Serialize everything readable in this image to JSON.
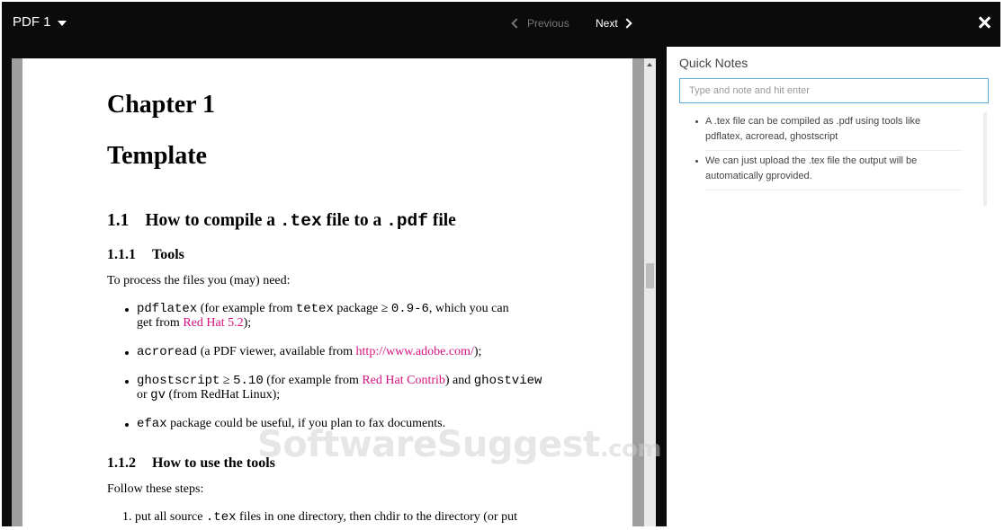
{
  "header": {
    "doc_selector": "PDF 1",
    "prev_label": "Previous",
    "next_label": "Next"
  },
  "document": {
    "chapter": "Chapter 1",
    "title": "Template",
    "section": {
      "number": "1.1",
      "pre": "How to compile a",
      "code1": ".tex",
      "mid": "file to a",
      "code2": ".pdf",
      "post": "file"
    },
    "sub1": {
      "number": "1.1.1",
      "title": "Tools"
    },
    "intro": "To process the files you (may) need:",
    "bullets": {
      "b1": {
        "code": "pdflatex",
        "t1": "(for example from",
        "code2": "tetex",
        "t2": "package ≥",
        "code3": "0.9-6",
        "t3": ", which you can",
        "line2": "get from",
        "link": "Red Hat 5.2",
        "end": ");"
      },
      "b2": {
        "code": "acroread",
        "t1": "(a PDF viewer, available from",
        "link": "http://www.adobe.com/",
        "end": ");"
      },
      "b3": {
        "code": "ghostscript",
        "t1": "≥",
        "code2": "5.10",
        "t2": "(for example from",
        "link": "Red Hat Contrib",
        "t3": ") and",
        "code3": "ghostview",
        "line2a": "or",
        "code4": "gv",
        "line2b": "(from RedHat Linux);"
      },
      "b4": {
        "code": "efax",
        "t1": "package could be useful, if you plan to fax documents."
      }
    },
    "sub2": {
      "number": "1.1.2",
      "title": "How to use the tools"
    },
    "steps_intro": "Follow these steps:",
    "step1": {
      "num": "1.",
      "t1": "put all source",
      "code": ".tex",
      "t2": "files in one directory, then chdir to the directory (or put"
    }
  },
  "notes": {
    "title": "Quick Notes",
    "placeholder": "Type and note and hit enter",
    "items": [
      {
        "line1": "A .tex file can be compiled as .pdf using tools like",
        "line2": "pdflatex, acroread, ghostscript"
      },
      {
        "line1": "We can just upload the .tex file the output will be",
        "line2": "automatically gprovided."
      }
    ]
  },
  "watermark": {
    "text": "SoftwareSuggest",
    "suffix": ".com"
  },
  "colors": {
    "topbar": "#0b0b0b",
    "link": "#d4127f",
    "input_border": "#5fa9d9",
    "viewer_bg": "#9e9e9e"
  }
}
